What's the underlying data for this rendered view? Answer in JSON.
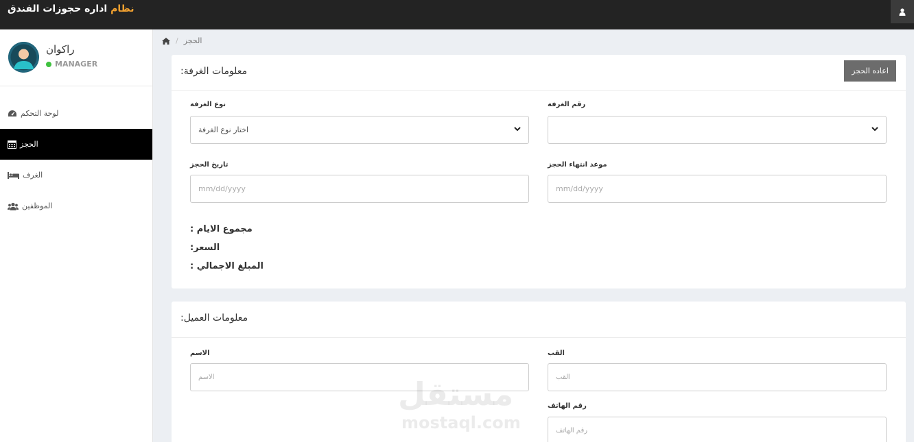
{
  "header": {
    "brand_accent": "نظام",
    "brand_rest": " اداره حجوزات الفندق"
  },
  "profile": {
    "name": "راكوان",
    "role": "MANAGER"
  },
  "sidebar": {
    "items": [
      {
        "label": "لوحة التحكم",
        "icon": "dashboard-icon"
      },
      {
        "label": "الحجز",
        "icon": "calendar-icon",
        "active": true
      },
      {
        "label": "الغرف",
        "icon": "bed-icon"
      },
      {
        "label": "الموظفين",
        "icon": "users-icon"
      }
    ]
  },
  "breadcrumb": {
    "current": "الحجز",
    "separator": "/"
  },
  "room_panel": {
    "title": ":معلومات الغرفة",
    "reset_label": "اعاده الحجز",
    "room_type_label": "نوع الغرفة",
    "room_type_value": "اختار نوع الغرفة",
    "room_number_label": "رقم الغرفة",
    "room_number_value": "",
    "booking_date_label": "تاريخ الحجز",
    "booking_date_placeholder": "mm/dd/yyyy",
    "end_date_label": "موعد انتهاء الحجز",
    "end_date_placeholder": "mm/dd/yyyy",
    "total_days_label": ": مجموع الايام",
    "price_label": ":السعر",
    "total_amount_label": ": المبلغ الاجمالي"
  },
  "client_panel": {
    "title": ":معلومات العميل",
    "first_name_label": "الاسم",
    "first_name_placeholder": "الاسم",
    "last_name_label": "القب",
    "last_name_placeholder": "القب",
    "phone_label": "رقم الهاتف",
    "phone_placeholder": "رقم الهاتف"
  },
  "watermark": {
    "arabic": "مستقل",
    "latin": "mostaql.com"
  },
  "colors": {
    "topbar": "#232323",
    "accent": "#f0a030",
    "active_nav": "#000000",
    "button": "#6c6c6c",
    "status_online": "#3fc13f"
  }
}
